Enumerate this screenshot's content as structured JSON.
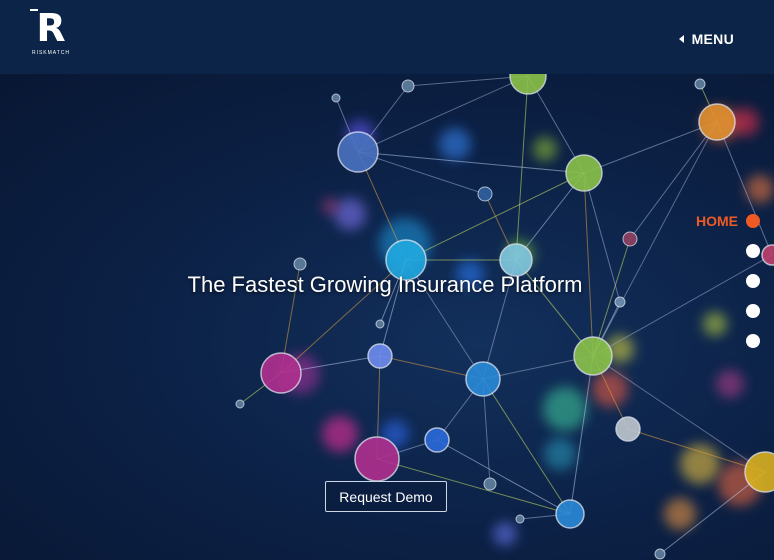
{
  "brand": {
    "logo_letter": "R",
    "logo_word": "RISKMATCH"
  },
  "header": {
    "menu_label": "MENU"
  },
  "hero": {
    "headline": "The Fastest Growing Insurance Platform",
    "cta_label": "Request Demo"
  },
  "side_nav": {
    "active_label": "HOME",
    "dots": [
      "home",
      "section-2",
      "section-3",
      "section-4",
      "section-5"
    ]
  },
  "colors": {
    "header_bg": "#0b2447",
    "accent": "#ef5a24",
    "text": "#ffffff"
  }
}
